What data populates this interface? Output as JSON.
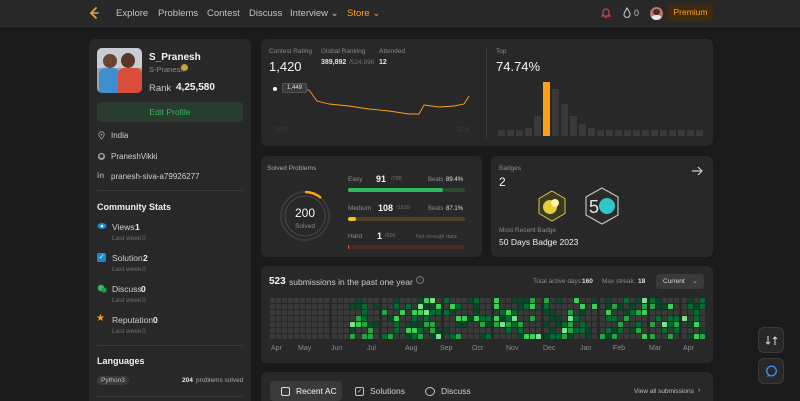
{
  "nav": {
    "links": [
      "Explore",
      "Problems",
      "Contest",
      "Discuss",
      "Interview ⌄",
      "Store ⌄"
    ],
    "premium": "Premium",
    "streak": "0"
  },
  "profile": {
    "name": "S_Pranesh",
    "username": "S-Pranesh",
    "rank": "Rank",
    "rank_value": "4,25,580",
    "edit_button": "Edit Profile",
    "location": "India",
    "github": "PraneshVikki",
    "linkedin": "pranesh-siva-a79926277"
  },
  "community": {
    "title": "Community Stats",
    "items": [
      {
        "label": "Views",
        "value": "1",
        "sub": "Last week",
        "sub_value": "0"
      },
      {
        "label": "Solution",
        "value": "2",
        "sub": "Last week",
        "sub_value": "0"
      },
      {
        "label": "Discuss",
        "value": "0",
        "sub": "Last week",
        "sub_value": "0"
      },
      {
        "label": "Reputation",
        "value": "0",
        "sub": "Last week",
        "sub_value": "0"
      }
    ]
  },
  "languages": {
    "title": "Languages",
    "items": [
      {
        "name": "Python3",
        "count": "204",
        "suffix": "problems solved"
      }
    ]
  },
  "contest": {
    "rating_label": "Contest Rating",
    "rating": "1,420",
    "ranking_label": "Global Ranking",
    "ranking": "389,892",
    "ranking_total": "/524,996",
    "attended_label": "Attended",
    "attended": "12",
    "tooltip": "1,449",
    "axis_left": "2023",
    "axis_right": "2024",
    "top_label": "Top",
    "top_value": "74.74%"
  },
  "solved": {
    "title": "Solved Problems",
    "total": "200",
    "total_label": "Solved",
    "easy": {
      "label": "Easy",
      "value": "91",
      "total": "/788",
      "beats_label": "Beats",
      "beats": "89.4%"
    },
    "medium": {
      "label": "Medium",
      "value": "108",
      "total": "/1639",
      "beats_label": "Beats",
      "beats": "87.1%"
    },
    "hard": {
      "label": "Hard",
      "value": "1",
      "total": "/696",
      "beats_note": "Not enough data"
    }
  },
  "badges": {
    "label": "Badges",
    "count": "2",
    "recent_label": "Most Recent Badge",
    "recent_name": "50 Days Badge 2023"
  },
  "submissions": {
    "count": "523",
    "text": "submissions in the past one year",
    "active_days_label": "Total active days:",
    "active_days": "160",
    "max_streak_label": "Max streak:",
    "max_streak": "18",
    "select": "Current",
    "months": [
      "Apr",
      "May",
      "Jun",
      "Jul",
      "Aug",
      "Sep",
      "Oct",
      "Nov",
      "Dec",
      "Jan",
      "Feb",
      "Mar",
      "Apr"
    ]
  },
  "tabs": {
    "recent": "Recent AC",
    "solutions": "Solutions",
    "discuss": "Discuss",
    "view_all": "View all submissions"
  },
  "colors": {
    "accent": "#ffa116",
    "easy": "#2cbb5d",
    "medium": "#ffc01e",
    "hard": "#ef4743"
  }
}
